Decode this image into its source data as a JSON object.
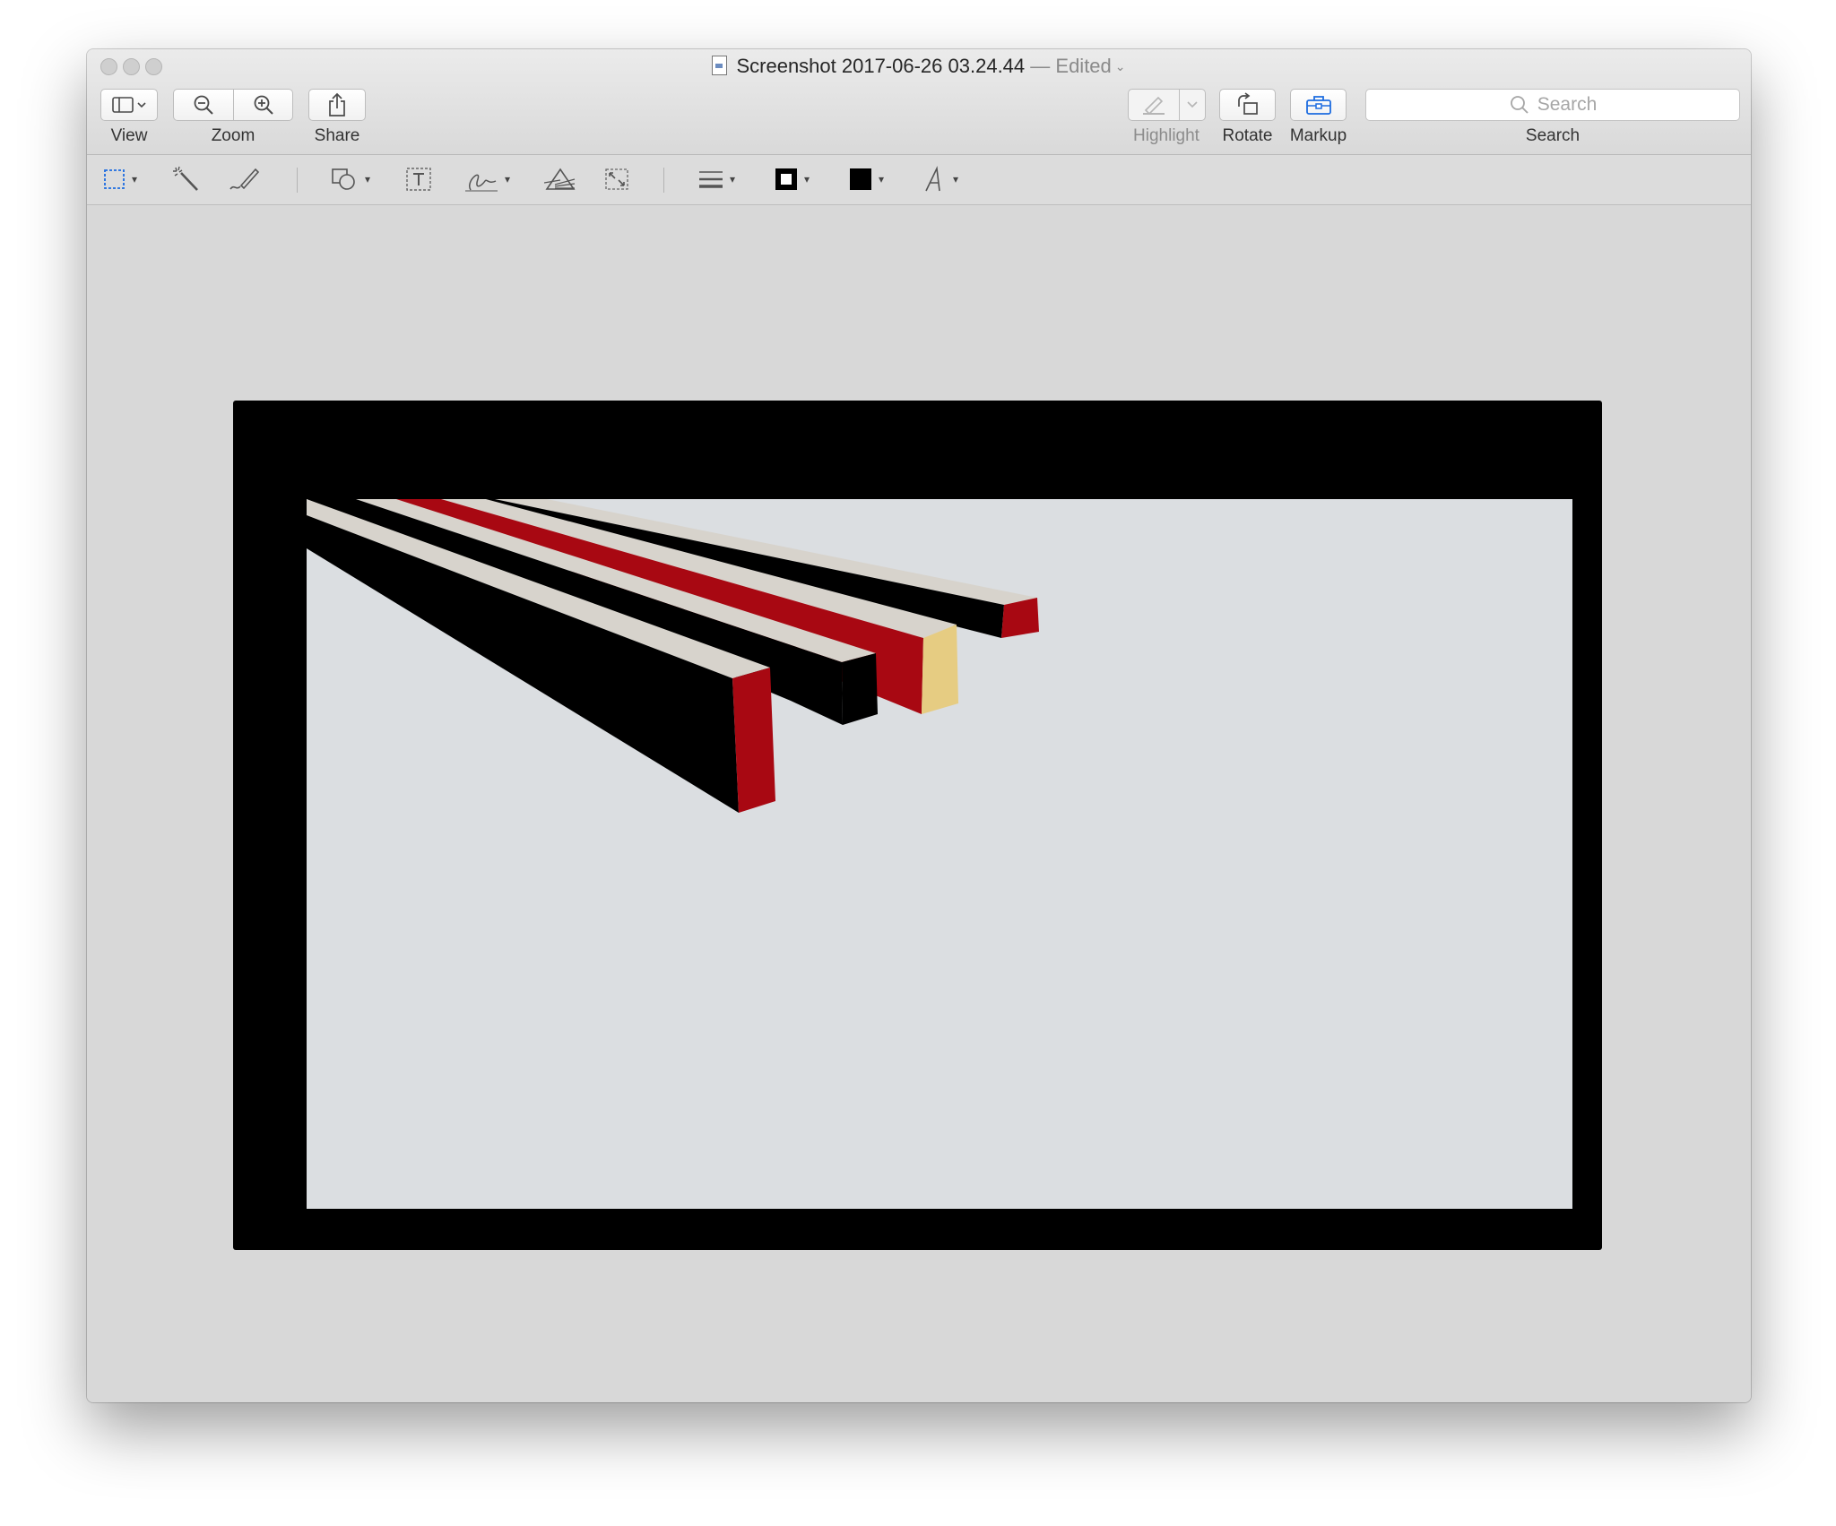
{
  "window": {
    "title": "Screenshot 2017-06-26 03.24.44",
    "title_separator": " — ",
    "edited_label": "Edited"
  },
  "toolbar": {
    "view_label": "View",
    "zoom_label": "Zoom",
    "share_label": "Share",
    "highlight_label": "Highlight",
    "rotate_label": "Rotate",
    "markup_label": "Markup",
    "search_label": "Search",
    "search_placeholder": "Search"
  },
  "markup_tools": [
    {
      "name": "rectangular-selection",
      "icon": "dashed-rect-icon"
    },
    {
      "name": "instant-alpha",
      "icon": "magic-wand-icon"
    },
    {
      "name": "sketch",
      "icon": "pen-icon"
    },
    {
      "name": "shapes",
      "icon": "shapes-icon"
    },
    {
      "name": "text",
      "icon": "text-box-icon"
    },
    {
      "name": "sign",
      "icon": "signature-icon"
    },
    {
      "name": "adjust-color",
      "icon": "prism-icon"
    },
    {
      "name": "adjust-size",
      "icon": "resize-icon"
    },
    {
      "name": "shape-style",
      "icon": "line-style-icon"
    },
    {
      "name": "border-color",
      "icon": "border-color-icon"
    },
    {
      "name": "fill-color",
      "icon": "fill-color-icon"
    },
    {
      "name": "text-style",
      "icon": "font-icon"
    }
  ],
  "colors": {
    "accent": "#1d6ce0",
    "frame": "#000000",
    "scene_background": "#dbdee1",
    "beam_red": "#a80812",
    "beam_black": "#000000",
    "beam_light": "#d7d3cc",
    "beam_end_tan": "#e6cc82",
    "fill_color_swatch": "#000000"
  }
}
